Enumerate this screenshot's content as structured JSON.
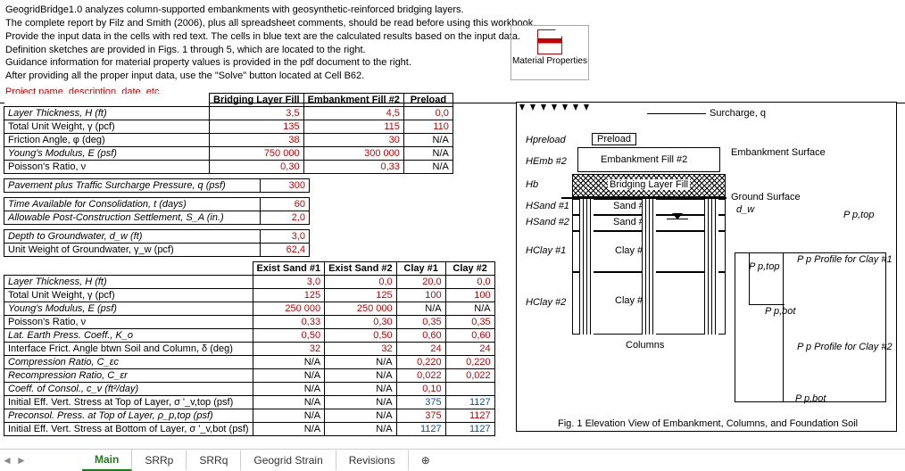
{
  "intro": {
    "l1": "GeogridBridge1.0 analyzes column-supported embankments with geosynthetic-reinforced bridging layers.",
    "l2": "The complete report by Filz and Smith (2006), plus all spreadsheet comments, should be read before using this workbook.",
    "l3": "Provide the input data in the cells with red text.  The cells in blue text are the calculated results based on the input data.",
    "l4": "Definition sketches are provided in Figs. 1 through 5, which are located to the right.",
    "l5": "Guidance information for material property values is provided in the pdf document to the right.",
    "l6": "After providing all the proper input data, use the \"Solve\" button located at Cell B62."
  },
  "project_label": "Project name, description, date, etc.",
  "pdf_label": "Material Properties",
  "headers1": {
    "c1": "Bridging Layer Fill",
    "c2": "Embankment Fill #2",
    "c3": "Preload"
  },
  "rows1": {
    "lt": "Layer Thickness, H  (ft)",
    "tuw": "Total Unit Weight, γ  (pcf)",
    "fa": "Friction Angle, φ  (deg)",
    "ym": "Young's Modulus, E  (psf)",
    "pr": "Poisson's Ratio, ν"
  },
  "vals1": {
    "lt": [
      "3,5",
      "4,5",
      "0,0"
    ],
    "tuw": [
      "135",
      "115",
      "110"
    ],
    "fa": [
      "38",
      "30",
      "N/A"
    ],
    "ym": [
      "750 000",
      "300 000",
      "N/A"
    ],
    "pr": [
      "0,30",
      "0,33",
      "N/A"
    ]
  },
  "rows2": {
    "psp": "Pavement plus Traffic Surcharge Pressure, q  (psf)",
    "psp_v": "300",
    "tac": "Time Available for Consolidation, t  (days)",
    "tac_v": "60",
    "apcs": "Allowable Post-Construction Settlement, S_A  (in.)",
    "apcs_v": "2,0",
    "dg": "Depth to Groundwater, d_w  (ft)",
    "dg_v": "3,0",
    "uwg": "Unit Weight of Groundwater, γ_w  (pcf)",
    "uwg_v": "62,4"
  },
  "headers3": {
    "c1": "Exist Sand #1",
    "c2": "Exist Sand #2",
    "c3": "Clay #1",
    "c4": "Clay #2"
  },
  "rows3": {
    "lt": {
      "label": "Layer Thickness, H  (ft)",
      "v": [
        "3,0",
        "0,0",
        "20,0",
        "0,0"
      ]
    },
    "tuw": {
      "label": "Total Unit Weight, γ  (pcf)",
      "v": [
        "125",
        "125",
        "100",
        "100"
      ]
    },
    "ym": {
      "label": "Young's Modulus, E  (psf)",
      "v": [
        "250 000",
        "250 000",
        "N/A",
        "N/A"
      ]
    },
    "pr": {
      "label": "Poisson's Ratio, ν",
      "v": [
        "0,33",
        "0,30",
        "0,35",
        "0,35"
      ]
    },
    "kep": {
      "label": "Lat. Earth Press. Coeff., K_o",
      "v": [
        "0,50",
        "0,50",
        "0,60",
        "0,60"
      ]
    },
    "ifa": {
      "label": "Interface Frict. Angle btwn Soil and Column, δ (deg)",
      "v": [
        "32",
        "32",
        "24",
        "24"
      ]
    },
    "cr": {
      "label": "Compression Ratio, C_εc",
      "v": [
        "N/A",
        "N/A",
        "0,220",
        "0,220"
      ]
    },
    "rr": {
      "label": "Recompression Ratio, C_εr",
      "v": [
        "N/A",
        "N/A",
        "0,022",
        "0,022"
      ]
    },
    "cc": {
      "label": "Coeff. of Consol., c_v  (ft²/day)",
      "v": [
        "N/A",
        "N/A",
        "0,10",
        ""
      ]
    },
    "ievt": {
      "label": "Initial Eff. Vert. Stress at Top of Layer, σ '_v,top (psf)",
      "v": [
        "N/A",
        "N/A",
        "375",
        "1127"
      ]
    },
    "pcp": {
      "label": "Preconsol. Press. at Top of Layer, ρ_p,top  (psf)",
      "v": [
        "N/A",
        "N/A",
        "375",
        "1127"
      ]
    },
    "ievb": {
      "label": "Initial Eff. Vert. Stress at Bottom of Layer, σ '_v,bot  (psf)",
      "v": [
        "N/A",
        "N/A",
        "1127",
        "1127"
      ]
    }
  },
  "diagram": {
    "preload": "Preload",
    "surcharge": "Surcharge, q",
    "h_pre": "Hpreload",
    "h_emb": "HEmb #2",
    "h_b": "Hb",
    "h_s1": "HSand #1",
    "h_s2": "HSand #2",
    "h_c1": "HClay #1",
    "h_c2": "HClay #2",
    "embfill": "Embankment Fill #2",
    "embsurf": "Embankment Surface",
    "blf": "Bridging Layer Fill",
    "ground": "Ground Surface",
    "sand1": "Sand #1",
    "sand2": "Sand #2",
    "clay1": "Clay #1",
    "clay2": "Clay #2",
    "columns": "Columns",
    "dw": "d_w",
    "pptop": "P p,top",
    "ppbot": "P p,bot",
    "ppc1": "P p  Profile for Clay #1",
    "ppc2": "P p  Profile for Clay #2",
    "caption": "Fig. 1  Elevation View of Embankment, Columns, and Foundation Soil"
  },
  "tabs": {
    "main": "Main",
    "srrp": "SRRp",
    "srrq": "SRRq",
    "gs": "Geogrid Strain",
    "rev": "Revisions"
  }
}
